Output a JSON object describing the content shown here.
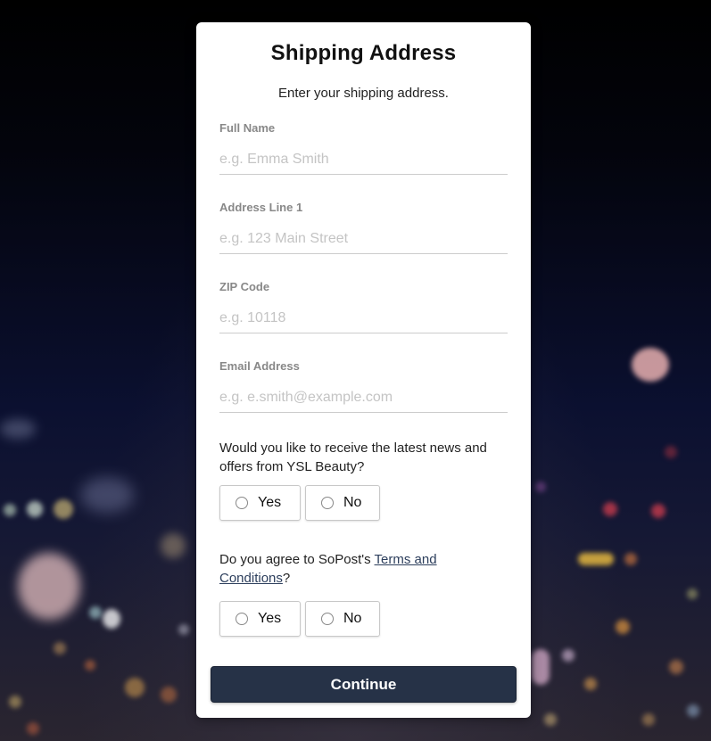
{
  "form": {
    "title": "Shipping Address",
    "subtitle": "Enter your shipping address.",
    "fields": [
      {
        "label": "Full Name",
        "placeholder": "e.g. Emma Smith",
        "value": ""
      },
      {
        "label": "Address Line 1",
        "placeholder": "e.g. 123 Main Street",
        "value": ""
      },
      {
        "label": "ZIP Code",
        "placeholder": "e.g. 10118",
        "value": ""
      },
      {
        "label": "Email Address",
        "placeholder": "e.g. e.smith@example.com",
        "value": ""
      }
    ],
    "newsletter": {
      "question": "Would you like to receive the latest news and offers from YSL Beauty?",
      "yes_label": "Yes",
      "no_label": "No",
      "selected": null
    },
    "terms": {
      "question_prefix": "Do you agree to SoPost's ",
      "link_text": "Terms and Conditions",
      "question_suffix": "?",
      "yes_label": "Yes",
      "no_label": "No",
      "selected": null
    },
    "continue_label": "Continue"
  },
  "colors": {
    "button": "#263247",
    "link": "#2c3e5c",
    "card": "#ffffff",
    "placeholder": "#c4c4c4",
    "label": "#888888"
  }
}
